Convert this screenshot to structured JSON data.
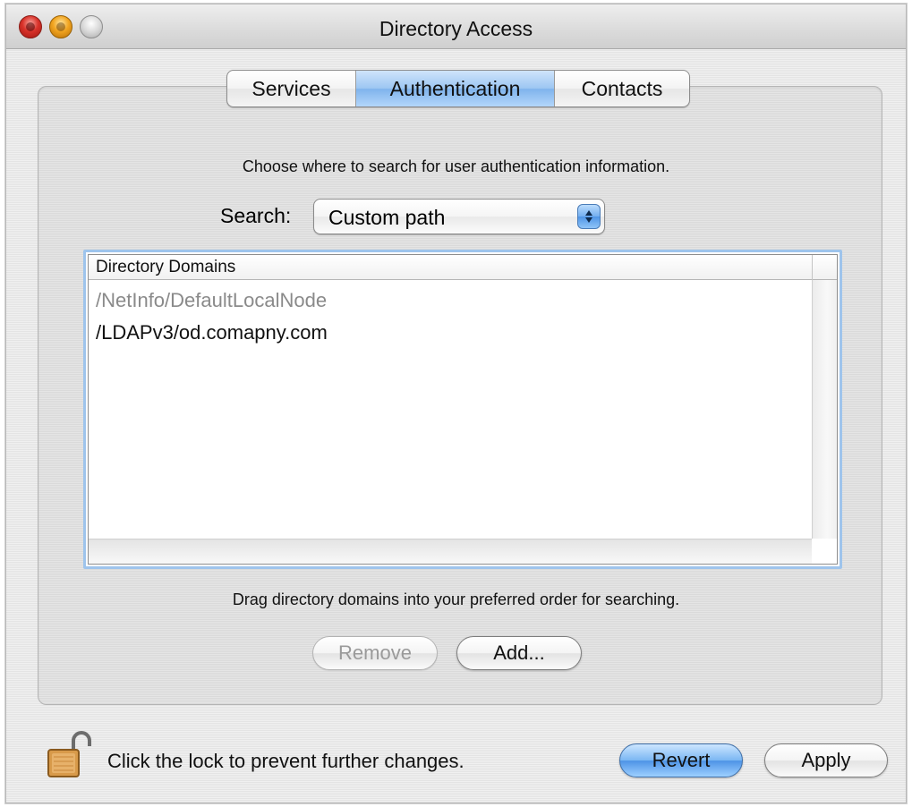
{
  "window": {
    "title": "Directory Access"
  },
  "tabs": [
    {
      "label": "Services"
    },
    {
      "label": "Authentication",
      "selected": true
    },
    {
      "label": "Contacts"
    }
  ],
  "authentication": {
    "instruction": "Choose where to search for user authentication information.",
    "search_label": "Search:",
    "search_value": "Custom path",
    "table": {
      "column_header": "Directory Domains",
      "rows": [
        {
          "path": "/NetInfo/DefaultLocalNode",
          "dimmed": true
        },
        {
          "path": "/LDAPv3/od.comapny.com",
          "dimmed": false
        }
      ]
    },
    "drag_hint": "Drag directory domains into your preferred order for searching.",
    "buttons": {
      "remove": "Remove",
      "add": "Add..."
    }
  },
  "footer": {
    "lock_text": "Click the lock to prevent further changes.",
    "lock_icon": "unlocked-padlock-icon",
    "revert": "Revert",
    "apply": "Apply"
  },
  "colors": {
    "selection_blue": "#7fb3ec",
    "default_button_blue": "#4d93e6",
    "dimmed_text": "#8a8a8a"
  }
}
